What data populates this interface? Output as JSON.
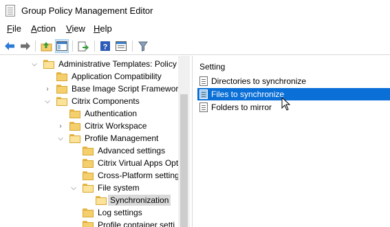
{
  "window": {
    "title": "Group Policy Management Editor"
  },
  "menu": [
    {
      "label": "File",
      "accel": "F",
      "rest": "ile"
    },
    {
      "label": "Action",
      "accel": "A",
      "rest": "ction"
    },
    {
      "label": "View",
      "accel": "V",
      "rest": "iew"
    },
    {
      "label": "Help",
      "accel": "H",
      "rest": "elp"
    }
  ],
  "toolbar": [
    "back-icon",
    "forward-icon",
    "up-folder-icon",
    "show-hide-tree-icon",
    "export-list-icon",
    "help-icon",
    "properties-icon",
    "filter-icon"
  ],
  "tree": [
    {
      "label": "Administrative Templates: Policy",
      "expander": "expanded"
    },
    {
      "label": "Application Compatibility",
      "expander": "none"
    },
    {
      "label": "Base Image Script Framework",
      "expander": "collapsed"
    },
    {
      "label": "Citrix Components",
      "expander": "expanded"
    },
    {
      "label": "Authentication",
      "expander": "none"
    },
    {
      "label": "Citrix Workspace",
      "expander": "collapsed"
    },
    {
      "label": "Profile Management",
      "expander": "expanded"
    },
    {
      "label": "Advanced settings",
      "expander": "none"
    },
    {
      "label": "Citrix Virtual Apps Opti",
      "expander": "none"
    },
    {
      "label": "Cross-Platform setting",
      "expander": "none"
    },
    {
      "label": "File system",
      "expander": "expanded"
    },
    {
      "label": "Synchronization",
      "expander": "none",
      "selected": true
    },
    {
      "label": "Log settings",
      "expander": "none"
    },
    {
      "label": "Profile container setti",
      "expander": "none"
    }
  ],
  "settings": {
    "column_header": "Setting",
    "items": [
      {
        "label": "Directories to synchronize",
        "selected": false
      },
      {
        "label": "Files to synchronize",
        "selected": true
      },
      {
        "label": "Folders to mirror",
        "selected": false
      }
    ]
  },
  "colors": {
    "selection": "#0a6fd6",
    "folder": "#f5cf6b",
    "tree_selected": "#d9d9d9"
  }
}
